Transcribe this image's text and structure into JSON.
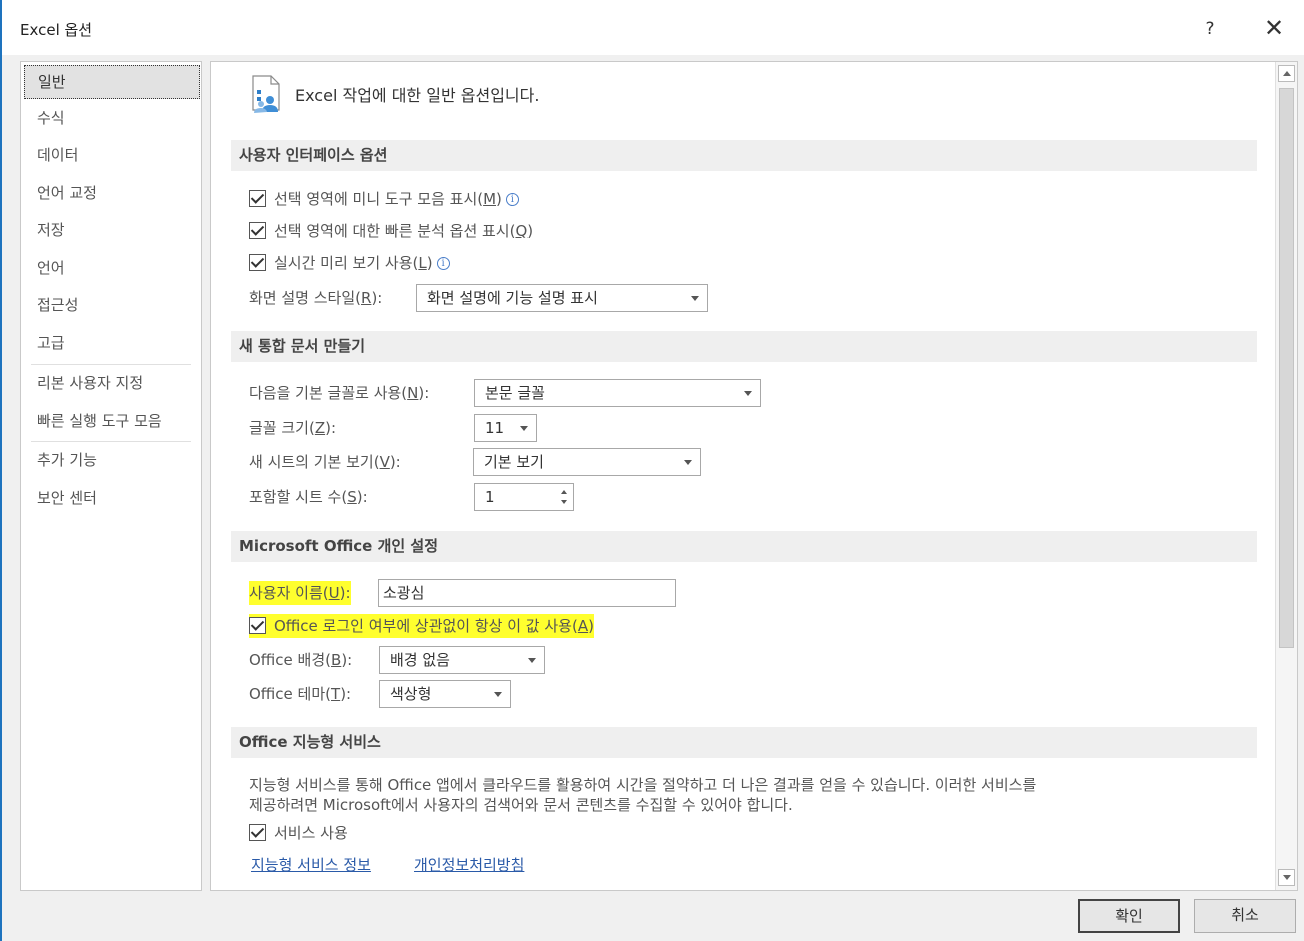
{
  "window": {
    "title": "Excel 옵션",
    "help_label": "?",
    "close_label": "✕"
  },
  "sidebar": {
    "items": [
      {
        "label": "일반"
      },
      {
        "label": "수식"
      },
      {
        "label": "데이터"
      },
      {
        "label": "언어 교정"
      },
      {
        "label": "저장"
      },
      {
        "label": "언어"
      },
      {
        "label": "접근성"
      },
      {
        "label": "고급"
      },
      {
        "label": "리본 사용자 지정"
      },
      {
        "label": "빠른 실행 도구 모음"
      },
      {
        "label": "추가 기능"
      },
      {
        "label": "보안 센터"
      }
    ],
    "selected": "일반"
  },
  "main": {
    "header": "Excel 작업에 대한 일반 옵션입니다.",
    "ui_options": {
      "title": "사용자 인터페이스 옵션",
      "mini_toolbar": {
        "label": "선택 영역에 미니 도구 모음 표시(",
        "key": "M",
        "end": ")",
        "checked": true
      },
      "quick_analysis": {
        "label": "선택 영역에 대한 빠른 분석 옵션 표시(",
        "key": "Q",
        "end": ")",
        "checked": true
      },
      "live_preview": {
        "label": "실시간 미리 보기 사용(",
        "key": "L",
        "end": ")",
        "checked": true
      },
      "screentip": {
        "label": "화면 설명 스타일(",
        "key": "R",
        "end": "):",
        "value": "화면 설명에 기능 설명 표시"
      }
    },
    "new_workbook": {
      "title": "새 통합 문서 만들기",
      "font": {
        "label": "다음을 기본 글꼴로 사용(",
        "key": "N",
        "end": "):",
        "value": "본문 글꼴"
      },
      "font_size": {
        "label": "글꼴 크기(",
        "key": "Z",
        "end": "):",
        "value": "11"
      },
      "default_view": {
        "label": "새 시트의 기본 보기(",
        "key": "V",
        "end": "):",
        "value": "기본 보기"
      },
      "sheet_count": {
        "label": "포함할 시트 수(",
        "key": "S",
        "end": "):",
        "value": "1"
      }
    },
    "personalize": {
      "title": "Microsoft Office 개인 설정",
      "user_name": {
        "label": "사용자 이름(",
        "key": "U",
        "end": "):",
        "value": "소광심"
      },
      "always_use": {
        "label": "Office 로그인 여부에 상관없이 항상 이 값 사용(",
        "key": "A",
        "end": ")",
        "checked": true
      },
      "background": {
        "label": "Office 배경(",
        "key": "B",
        "end": "):",
        "value": "배경 없음"
      },
      "theme": {
        "label": "Office 테마(",
        "key": "T",
        "end": "):",
        "value": "색상형"
      }
    },
    "intelligent": {
      "title": "Office 지능형 서비스",
      "description_line1": "지능형 서비스를 통해 Office 앱에서 클라우드를 활용하여 시간을 절약하고 더 나은 결과를 얻을 수 있습니다. 이러한 서비스를",
      "description_line2": "제공하려면 Microsoft에서 사용자의 검색어와 문서 콘텐츠를 수집할 수 있어야 합니다.",
      "enable": {
        "label": "서비스 사용",
        "checked": true
      },
      "link_info": "지능형 서비스 정보",
      "link_privacy": "개인정보처리방침"
    }
  },
  "footer": {
    "ok_label": "확인",
    "cancel_label": "취소"
  },
  "colors": {
    "highlight": "#ffff2e",
    "link": "#2a5aa8",
    "window_border": "#1e73be"
  }
}
